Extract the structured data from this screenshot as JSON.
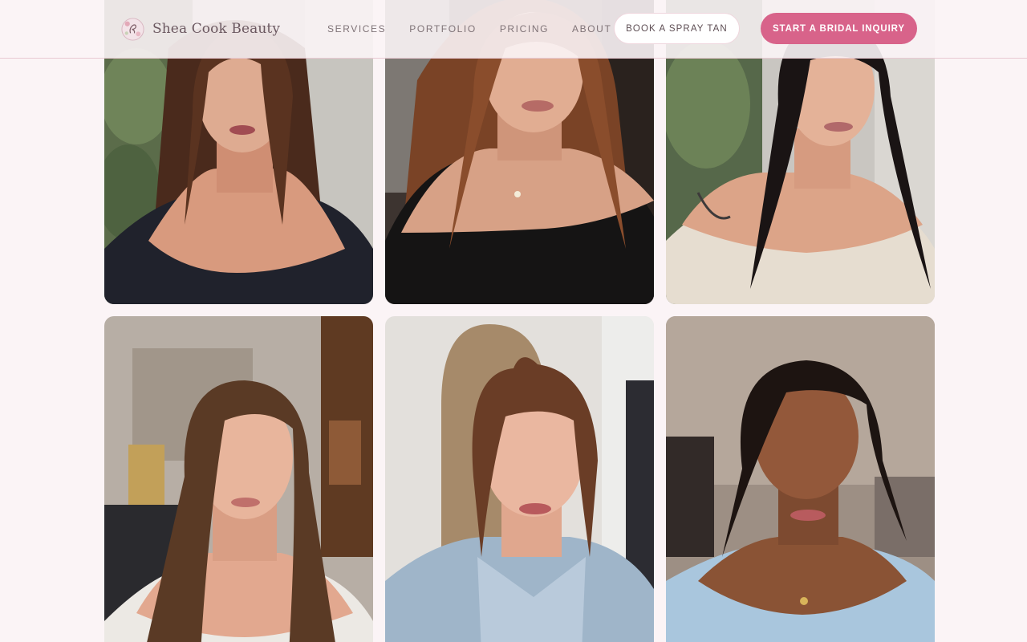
{
  "brand": {
    "name": "Shea Cook Beauty",
    "logo_icon": "floral-monogram-icon"
  },
  "nav": {
    "items": [
      {
        "label": "SERVICES"
      },
      {
        "label": "PORTFOLIO"
      },
      {
        "label": "PRICING"
      },
      {
        "label": "ABOUT"
      }
    ],
    "book_button": "BOOK A SPRAY TAN",
    "inquiry_button": "START A BRIDAL INQUIRY"
  },
  "colors": {
    "accent": "#d8638a",
    "background": "#fbf4f6",
    "border": "#e8c9d2"
  },
  "portfolio": {
    "photos": [
      {
        "subject": "makeup portrait, long brown hair, black off-shoulder top, eucalyptus backdrop"
      },
      {
        "subject": "makeup portrait, auburn wavy hair, black off-shoulder top, pendant necklace"
      },
      {
        "subject": "makeup portrait, long black wavy hair, cream off-shoulder top, eucalyptus backdrop"
      },
      {
        "subject": "makeup portrait, brown hollywood waves, white knit top, living room"
      },
      {
        "subject": "makeup portrait, auburn updo, light blue pleated shirt, archway"
      },
      {
        "subject": "makeup portrait, dark curly hair, light blue ruffled top, gold necklace"
      }
    ]
  }
}
